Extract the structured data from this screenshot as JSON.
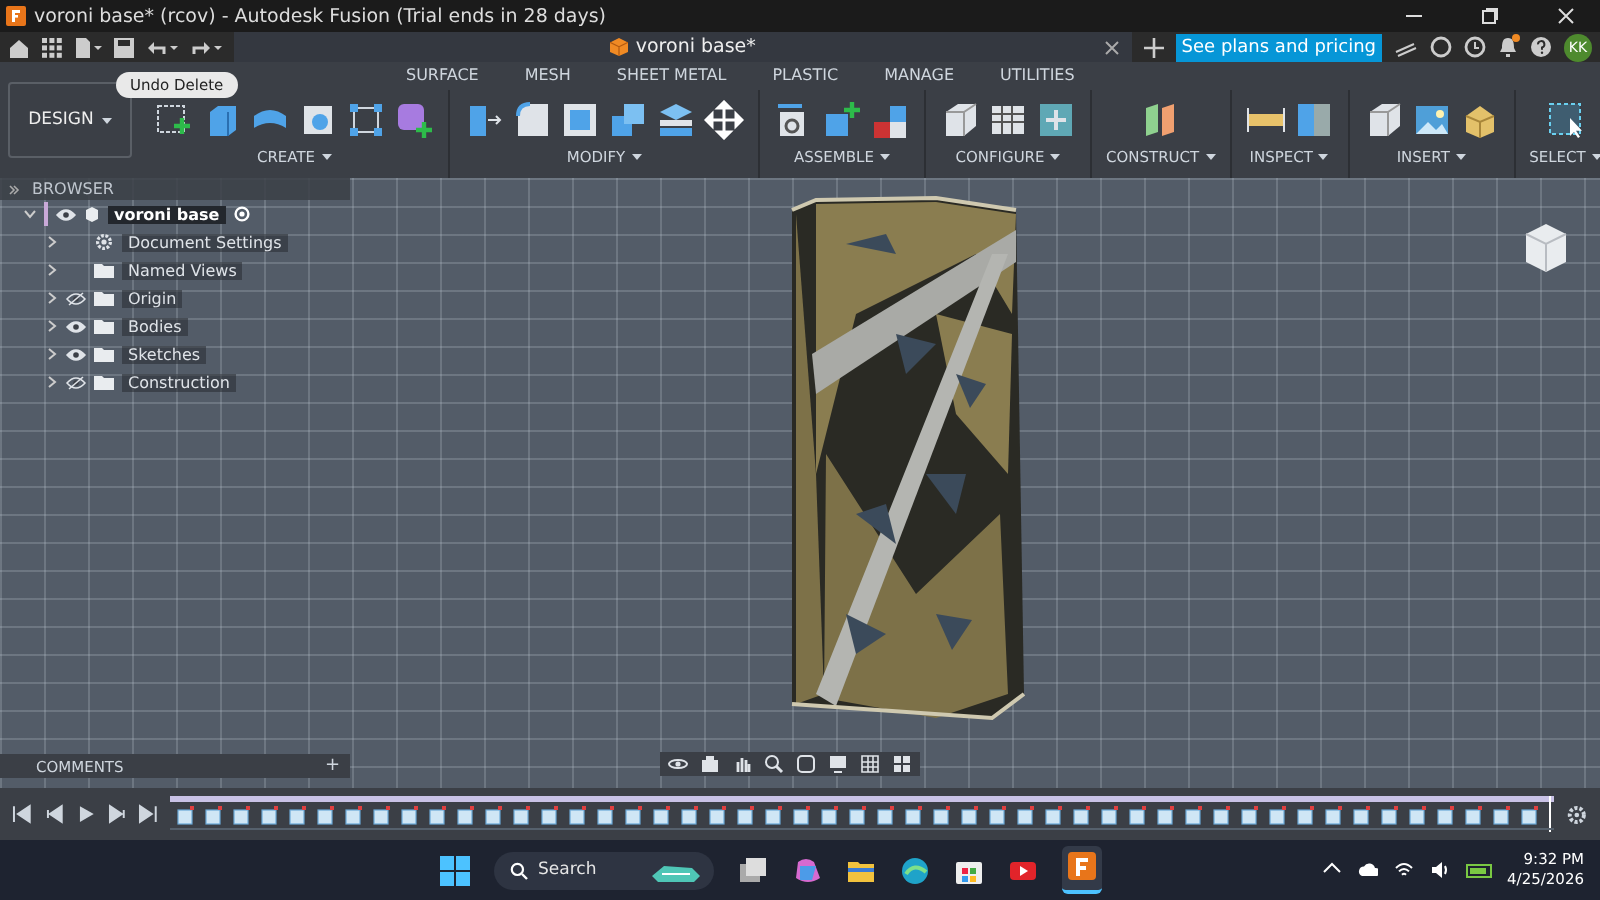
{
  "window": {
    "title": "voroni base* (rcov) - Autodesk Fusion (Trial ends in 28 days)"
  },
  "document_tab": {
    "label": "voroni base*"
  },
  "plans_button": {
    "label": "See plans and pricing"
  },
  "notifications": {
    "unread": true
  },
  "user": {
    "initials": "KK"
  },
  "tooltip": {
    "text": "Undo Delete"
  },
  "workspace": {
    "label": "DESIGN"
  },
  "ribbon_tabs": [
    {
      "label": "SURFACE",
      "selected": false
    },
    {
      "label": "MESH",
      "selected": false
    },
    {
      "label": "SHEET METAL",
      "selected": false
    },
    {
      "label": "PLASTIC",
      "selected": false
    },
    {
      "label": "MANAGE",
      "selected": false
    },
    {
      "label": "UTILITIES",
      "selected": false
    }
  ],
  "tool_groups": [
    {
      "label": "CREATE",
      "tools": [
        {
          "kind": "sketch"
        },
        {
          "kind": "extrude"
        },
        {
          "kind": "revolve"
        },
        {
          "kind": "hole"
        },
        {
          "kind": "pattern"
        },
        {
          "kind": "form"
        }
      ]
    },
    {
      "label": "MODIFY",
      "tools": [
        {
          "kind": "press"
        },
        {
          "kind": "fillet"
        },
        {
          "kind": "shell"
        },
        {
          "kind": "combine"
        },
        {
          "kind": "offset"
        },
        {
          "kind": "move"
        }
      ]
    },
    {
      "label": "ASSEMBLE",
      "tools": [
        {
          "kind": "joint"
        },
        {
          "kind": "component"
        },
        {
          "kind": "ground"
        }
      ]
    },
    {
      "label": "CONFIGURE",
      "tools": [
        {
          "kind": "box"
        },
        {
          "kind": "table"
        },
        {
          "kind": "config"
        }
      ]
    },
    {
      "label": "CONSTRUCT",
      "tools": [
        {
          "kind": "plane"
        }
      ]
    },
    {
      "label": "INSPECT",
      "tools": [
        {
          "kind": "measure"
        },
        {
          "kind": "section"
        }
      ]
    },
    {
      "label": "INSERT",
      "tools": [
        {
          "kind": "box"
        },
        {
          "kind": "image"
        },
        {
          "kind": "mesh"
        }
      ]
    },
    {
      "label": "SELECT",
      "tools": [
        {
          "kind": "select"
        }
      ]
    }
  ],
  "browser": {
    "title": "BROWSER",
    "root": {
      "label": "voroni base",
      "visible": true,
      "expanded": true,
      "selected": true,
      "children": [
        {
          "label": "Document Settings",
          "kind": "settings",
          "expanded": false,
          "selected": false
        },
        {
          "label": "Named Views",
          "kind": "folder",
          "expanded": false,
          "selected": false
        },
        {
          "label": "Origin",
          "kind": "folder",
          "visible": false,
          "expanded": false,
          "selected": false
        },
        {
          "label": "Bodies",
          "kind": "folder",
          "visible": true,
          "expanded": false,
          "selected": false
        },
        {
          "label": "Sketches",
          "kind": "folder",
          "visible": true,
          "expanded": false,
          "selected": false
        },
        {
          "label": "Construction",
          "kind": "folder",
          "visible": false,
          "expanded": false,
          "selected": false
        }
      ]
    }
  },
  "comments": {
    "title": "COMMENTS",
    "add": "+"
  },
  "taskbar": {
    "search": {
      "placeholder": "Search"
    },
    "time": "9:32 PM",
    "date": "4/25/2026"
  }
}
